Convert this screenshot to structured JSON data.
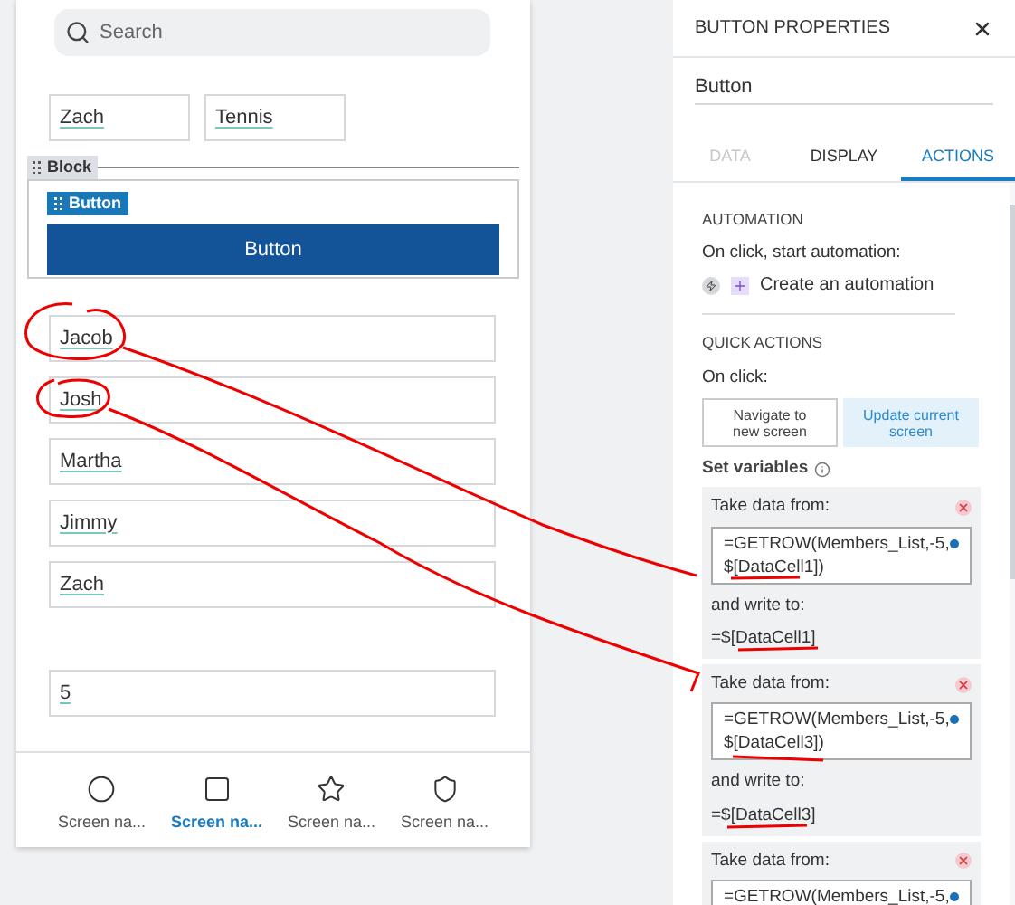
{
  "phone": {
    "search": {
      "placeholder": "Search"
    },
    "top_fields": [
      "Zach",
      "Tennis"
    ],
    "block": {
      "label": "Block",
      "button_tag": "Button",
      "button_label": "Button"
    },
    "list_fields": [
      "Jacob",
      "Josh",
      "Martha",
      "Jimmy",
      "Zach"
    ],
    "number_field": "5",
    "nav": [
      {
        "kind": "circle",
        "label": "Screen na...",
        "selected": false
      },
      {
        "kind": "square",
        "label": "Screen na...",
        "selected": true
      },
      {
        "kind": "star",
        "label": "Screen na...",
        "selected": false
      },
      {
        "kind": "shield",
        "label": "Screen na...",
        "selected": false
      }
    ]
  },
  "panel": {
    "title": "BUTTON PROPERTIES",
    "name_field": "Button",
    "tabs": [
      {
        "label": "DATA",
        "selected": false,
        "disabled": true
      },
      {
        "label": "DISPLAY",
        "selected": false,
        "disabled": false
      },
      {
        "label": "ACTIONS",
        "selected": true,
        "disabled": false
      }
    ],
    "automation": {
      "heading": "AUTOMATION",
      "caption": "On click, start automation:",
      "link": "Create an automation"
    },
    "quick_actions": {
      "heading": "QUICK ACTIONS",
      "caption": "On click:",
      "options": [
        {
          "label": "Navigate to new screen",
          "selected": false
        },
        {
          "label": "Update current screen",
          "selected": true
        }
      ]
    },
    "variables": {
      "heading": "Set variables",
      "items": [
        {
          "from_label": "Take data from:",
          "formula": "=GETROW(Members_List,-5, $[DataCell1])",
          "to_label": "and write to:",
          "target": "=$[DataCell1]"
        },
        {
          "from_label": "Take data from:",
          "formula": "=GETROW(Members_List,-5, $[DataCell3])",
          "to_label": "and write to:",
          "target": "=$[DataCell3]"
        },
        {
          "from_label": "Take data from:",
          "formula": "=GETROW(Members_List,-5,"
        }
      ]
    }
  }
}
